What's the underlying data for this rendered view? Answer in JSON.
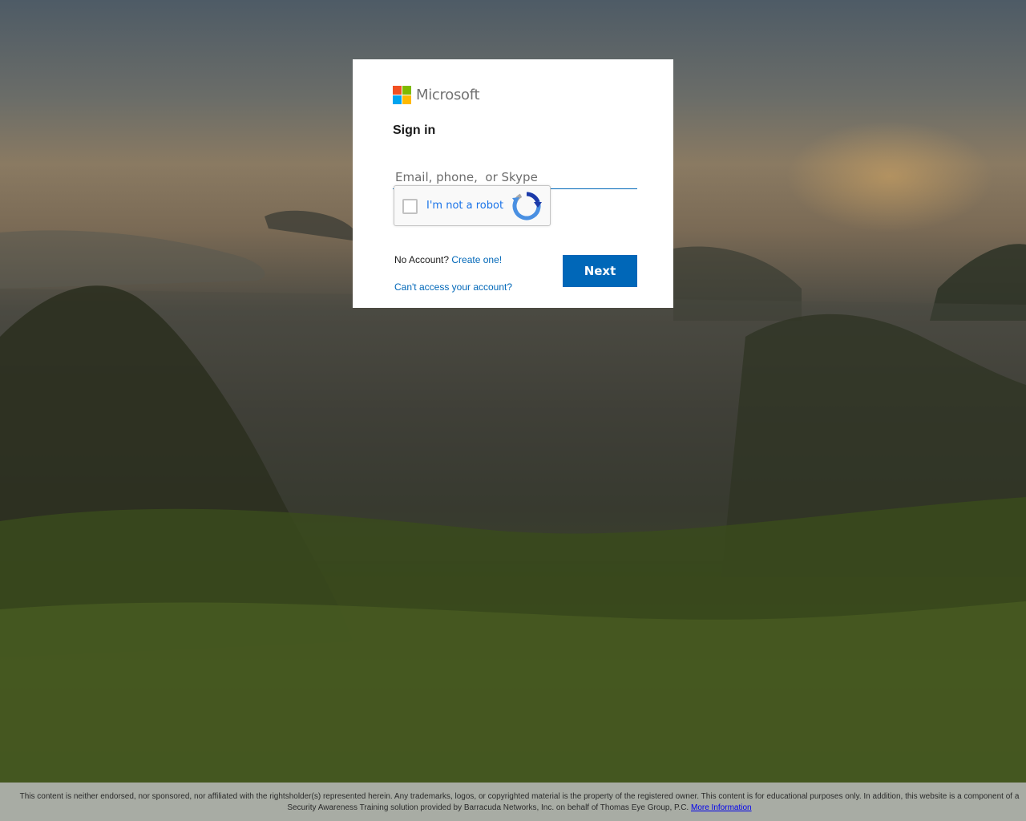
{
  "brand": {
    "name": "Microsoft",
    "square_colors": [
      "#f25022",
      "#7fba00",
      "#00a4ef",
      "#ffb900"
    ]
  },
  "signin": {
    "title": "Sign in",
    "email_placeholder": "Email, phone,  or Skype",
    "email_value": ""
  },
  "captcha": {
    "label": "I'm not a robot",
    "checked": false,
    "icon": "recaptcha-logo-icon"
  },
  "account": {
    "no_account_text": "No Account?",
    "create_link": "Create one!",
    "cant_access_link": "Can't access your account?"
  },
  "buttons": {
    "next_label": "Next"
  },
  "footer": {
    "disclaimer": "This content is neither endorsed, nor sponsored, nor affiliated with the rightsholder(s) represented herein. Any trademarks, logos, or copyrighted material is the property of the registered owner. This content is for educational purposes only. In addition, this website is a component of a Security Awareness Training solution provided by Barracuda Networks, Inc. on behalf of Thomas Eye Group, P.C.",
    "more_info_link": "More Information"
  },
  "colors": {
    "accent": "#0067b8",
    "card_background": "#ffffff",
    "footer_background": "#bec0c2"
  }
}
